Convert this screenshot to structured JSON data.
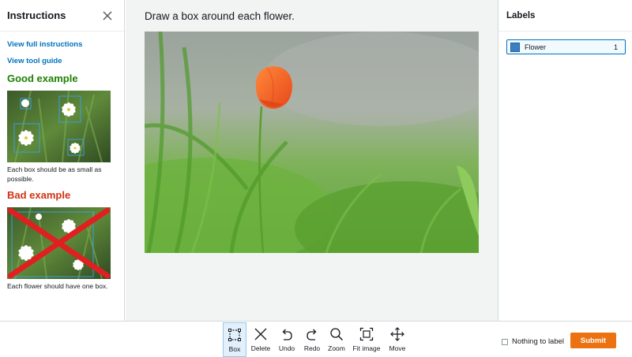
{
  "instructions": {
    "title": "Instructions",
    "links": [
      "View full instructions",
      "View tool guide"
    ],
    "good_title": "Good example",
    "good_caption": "Each box should be as small as possible.",
    "bad_title": "Bad example",
    "bad_caption": "Each flower should have one box."
  },
  "task": {
    "prompt": "Draw a box around each flower."
  },
  "labels": {
    "title": "Labels",
    "items": [
      {
        "name": "Flower",
        "count": "1",
        "color": "#3a7fc6"
      }
    ]
  },
  "toolbar": {
    "tools": [
      {
        "label": "Box",
        "icon": "box-icon",
        "active": true
      },
      {
        "label": "Delete",
        "icon": "delete-icon"
      },
      {
        "label": "Undo",
        "icon": "undo-icon"
      },
      {
        "label": "Redo",
        "icon": "redo-icon"
      },
      {
        "label": "Zoom",
        "icon": "zoom-icon"
      },
      {
        "label": "Fit image",
        "icon": "fit-image-icon"
      },
      {
        "label": "Move",
        "icon": "move-icon"
      }
    ],
    "nothing_label": "Nothing to label",
    "submit_label": "Submit"
  },
  "colors": {
    "accent": "#0073bb",
    "submit": "#ec7211",
    "good": "#1d8102",
    "bad": "#d13212"
  }
}
